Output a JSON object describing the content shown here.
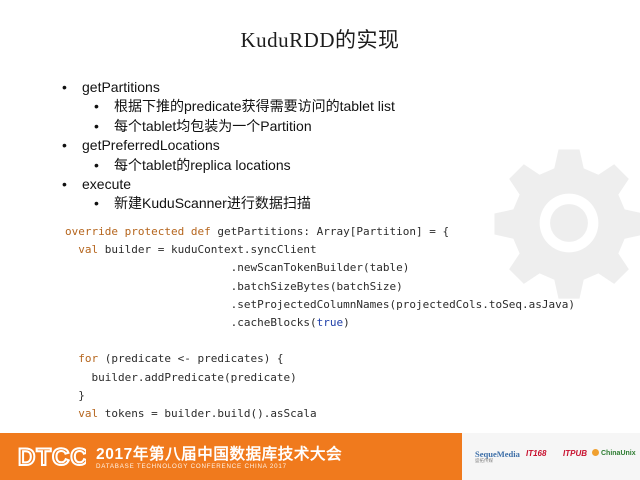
{
  "slide": {
    "title": "KuduRDD的实现",
    "bullets": [
      {
        "label": "getPartitions",
        "sub": [
          "根据下推的predicate获得需要访问的tablet list",
          "每个tablet均包装为一个Partition"
        ]
      },
      {
        "label": "getPreferredLocations",
        "sub": [
          "每个tablet的replica locations"
        ]
      },
      {
        "label": "execute",
        "sub": [
          "新建KuduScanner进行数据扫描"
        ]
      }
    ]
  },
  "code": {
    "line1": {
      "kw": "override protected def ",
      "rest": "getPartitions: Array[Partition] = {"
    },
    "line2": {
      "kw": "val ",
      "rest": "builder = kuduContext.syncClient"
    },
    "line3": ".newScanTokenBuilder(table)",
    "line4": ".batchSizeBytes(batchSize)",
    "line5": ".setProjectedColumnNames(projectedCols.toSeq.asJava)",
    "line6": {
      "pre": ".cacheBlocks(",
      "lit": "true",
      "post": ")"
    },
    "line7": {
      "kw": "for ",
      "rest": "(predicate <- predicates) {"
    },
    "line8": "builder.addPredicate(predicate)",
    "line9": "}",
    "line10": {
      "kw": "val ",
      "rest": "tokens = builder.build().asScala"
    }
  },
  "footer": {
    "logo_text": "DTCC",
    "title": "2017年第八届中国数据库技术大会",
    "subtitle": "DATABASE TECHNOLOGY CONFERENCE CHINA 2017",
    "sponsors": {
      "s1": "SequeMedia",
      "s1_small": "盛拓传媒",
      "s2": "IT168",
      "s3": "ITPUB",
      "s4": "ChinaUnix"
    }
  },
  "colors": {
    "footer_orange": "#f07a1d",
    "keyword": "#b5651d",
    "literal": "#1e3ea8"
  },
  "icons": {
    "watermark": "gear-icon"
  }
}
